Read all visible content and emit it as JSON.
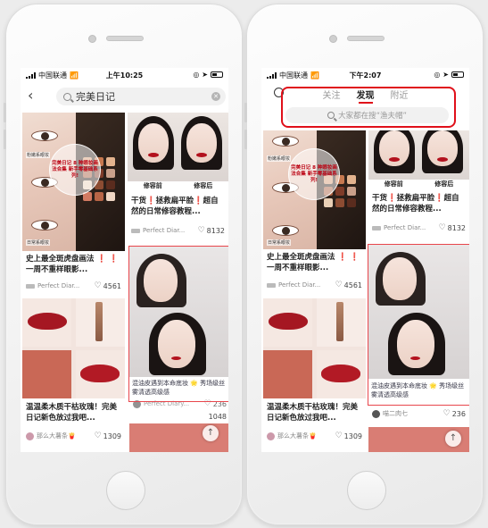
{
  "left": {
    "status": {
      "carrier": "中国联通",
      "time": "上午10:25"
    },
    "search_query": "完美日记",
    "cards": {
      "eye": {
        "stamp": "完美日记 8 种眼妆画法合集 新手零基础系列!",
        "caps": [
          "粉嫩系眼妆",
          "日常系眼妆"
        ],
        "title": "史上最全斑虎盘画法 ❗ ❗ 一周不重样眼影...",
        "author": "Perfect Diar...",
        "likes": "4561"
      },
      "face": {
        "labels": [
          "修容前",
          "修容后"
        ],
        "title": "干货❗拯救扁平脸❗超自然的日常修容教程...",
        "author": "Perfect Diar...",
        "likes": "8132"
      },
      "lip": {
        "title": "温温柔木质干枯玫瑰！完美日记新色放过我吧...",
        "author": "那么大薯条🍟",
        "likes": "1309"
      },
      "hl": {
        "text": "混油皮遇到本命底妆 🌟 秀场级丝雾清透高级感",
        "author": "Perfect Diary...",
        "likes": "236"
      },
      "extra_likes": "1048"
    }
  },
  "right": {
    "status": {
      "carrier": "中国联通",
      "time": "下午2:07"
    },
    "tabs": [
      "关注",
      "发现",
      "附近"
    ],
    "search_placeholder": "大家都在搜“渔夫帽”",
    "cards": {
      "eye": {
        "stamp": "完美日记 8 种眼妆画法合集 新手零基础系列!",
        "caps": [
          "粉嫩系眼妆",
          "日常系眼妆"
        ],
        "title": "史上最全斑虎盘画法 ❗ ❗ 一周不重样眼影...",
        "author": "Perfect Diar...",
        "likes": "4561"
      },
      "face": {
        "labels": [
          "修容前",
          "修容后"
        ],
        "title": "干货❗拯救扁平脸❗超自然的日常修容教程...",
        "author": "Perfect Diar...",
        "likes": "8132"
      },
      "lip": {
        "title": "温温柔木质干枯玫瑰！完美日记新色放过我吧...",
        "author": "那么大薯条🍟",
        "likes": "1309"
      },
      "hl": {
        "text": "混油皮遇到本命底妆 🌟 秀场级丝雾清透高级感",
        "author": "喵二肉七",
        "likes": "236"
      }
    }
  },
  "colors": {
    "brand_red": "#e0101a",
    "highlight": "#e8464c"
  }
}
